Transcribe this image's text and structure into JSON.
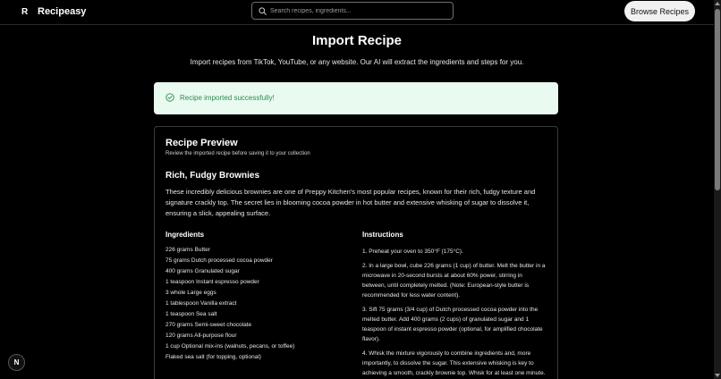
{
  "header": {
    "logo": "R",
    "brand": "Recipeasy",
    "search_placeholder": "Search recipes, ingredients...",
    "browse_label": "Browse Recipes"
  },
  "page": {
    "title": "Import Recipe",
    "subtitle": "Import recipes from TikTok, YouTube, or any website. Our AI will extract the ingredients and steps for you."
  },
  "alert": {
    "message": "Recipe imported successfully!",
    "color": "#2d8a4e"
  },
  "preview": {
    "title": "Recipe Preview",
    "subtitle": "Review the imported recipe before saving it to your collection",
    "recipe_title": "Rich, Fudgy Brownies",
    "description": "These incredibly delicious brownies are one of Preppy Kitchen's most popular recipes, known for their rich, fudgy texture and signature crackly top. The secret lies in blooming cocoa powder in hot butter and extensive whisking of sugar to dissolve it, ensuring a slick, appealing surface.",
    "ingredients_heading": "Ingredients",
    "ingredients": [
      "226 grams Butter",
      "75 grams Dutch processed cocoa powder",
      "400 grams Granulated sugar",
      "1 teaspoon Instant espresso powder",
      "3 whole Large eggs",
      "1 tablespoon Vanilla extract",
      "1 teaspoon Sea salt",
      "270 grams Semi-sweet chocolate",
      "120 grams All-purpose flour",
      "1 cup Optional mix-ins (walnuts, pecans, or toffee)",
      "Flaked sea salt (for topping, optional)"
    ],
    "instructions_heading": "Instructions",
    "instructions": [
      "1. Preheat your oven to 350°F (175°C).",
      "2. In a large bowl, cube 226 grams (1 cup) of butter. Melt the butter in a microwave in 20-second bursts at about 60% power, stirring in between, until completely melted. (Note: European-style butter is recommended for less water content).",
      "3. Sift 75 grams (3/4 cup) of Dutch processed cocoa powder into the melted butter. Add 400 grams (2 cups) of granulated sugar and 1 teaspoon of instant espresso powder (optional, for amplified chocolate flavor).",
      "4. Whisk the mixture vigorously to combine ingredients and, more importantly, to dissolve the sugar. This extensive whisking is key to achieving a smooth, crackly brownie top. Whisk for at least one minute."
    ]
  },
  "dev_badge": "N",
  "icons": {
    "search": "search-icon",
    "success": "check-circle-icon"
  }
}
